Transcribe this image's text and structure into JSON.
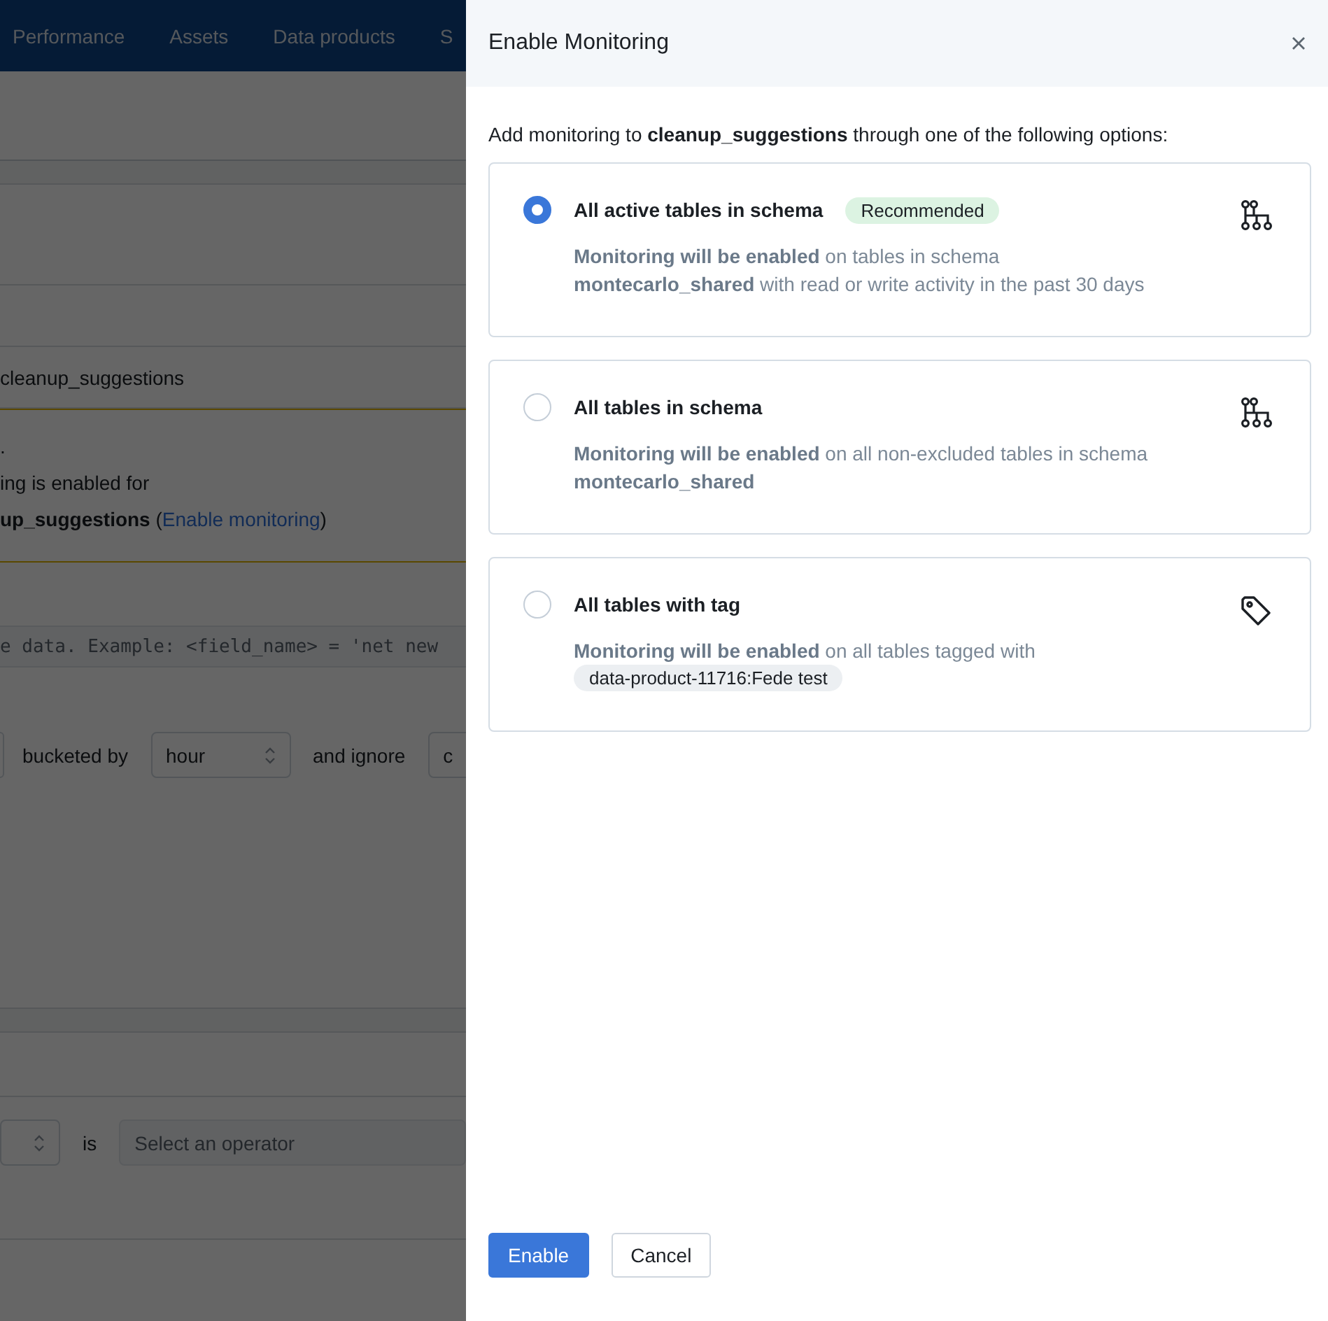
{
  "nav_tabs": [
    {
      "label": "Performance"
    },
    {
      "label": "Assets"
    },
    {
      "label": "Data products"
    },
    {
      "label": "S"
    }
  ],
  "background": {
    "table_name": "cleanup_suggestions",
    "notice_lines": [
      ".",
      "ing is enabled for"
    ],
    "notice_last": "**up_suggestions** (",
    "notice_link": "Enable monitoring",
    "notice_end": ")",
    "sql_placeholder": "e data. Example: <field_name> = 'net new",
    "bucketed_label": "bucketed by",
    "bucket_value": "hour",
    "ignore_label": "and ignore",
    "ignore_value": "c",
    "is_label": "is",
    "operator_placeholder": "Select an operator"
  },
  "drawer": {
    "title": "Enable Monitoring",
    "intro": "Add monitoring to **cleanup_suggestions** through one of the following options:"
  },
  "options": [
    {
      "title": "All active tables in schema",
      "badge": "Recommended",
      "description": "**Monitoring will be enabled** on tables in schema **montecarlo_shared** with read or write activity in the past 30 days",
      "kind": "schema",
      "selected": true
    },
    {
      "title": "All tables in schema",
      "description": "**Monitoring will be enabled** on all non-excluded tables in schema **montecarlo_shared**",
      "kind": "schema",
      "selected": false
    },
    {
      "title": "All tables with tag",
      "description": "**Monitoring will be enabled** on all tables tagged with",
      "tag": "data-product-11716:Fede test",
      "kind": "tag",
      "selected": false
    }
  ],
  "buttons": [
    {
      "label": "Enable",
      "kind": "primary"
    },
    {
      "label": "Cancel",
      "kind": "secondary"
    }
  ]
}
